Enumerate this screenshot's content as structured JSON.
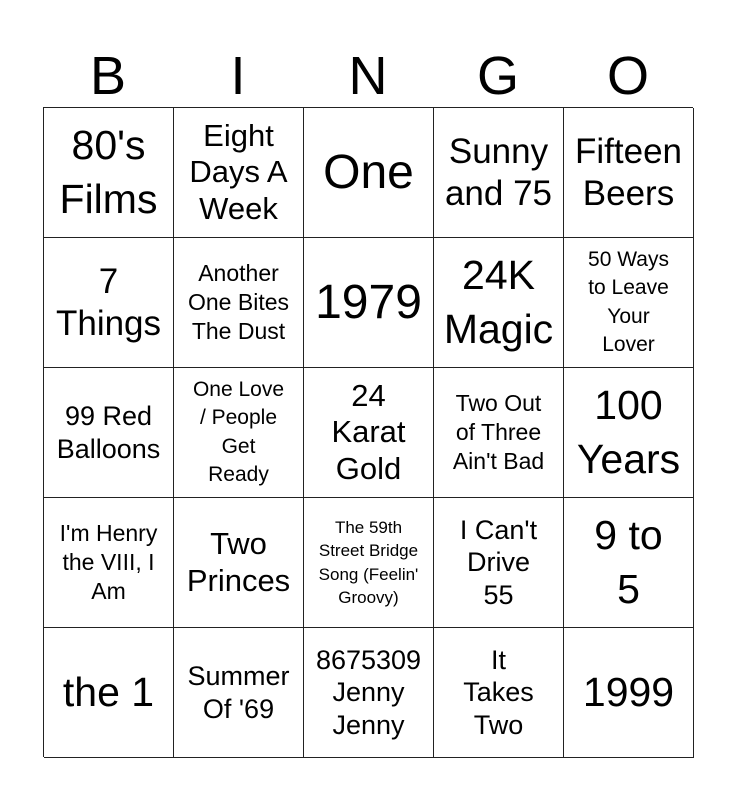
{
  "header": {
    "letters": [
      "B",
      "I",
      "N",
      "G",
      "O"
    ]
  },
  "board": {
    "rows": [
      [
        "80's\nFilms",
        "Eight\nDays A\nWeek",
        "One",
        "Sunny\nand 75",
        "Fifteen\nBeers"
      ],
      [
        "7\nThings",
        "Another\nOne Bites\nThe Dust",
        "1979",
        "24K\nMagic",
        "50 Ways\nto Leave\nYour\nLover"
      ],
      [
        "99 Red\nBalloons",
        "One Love\n/ People\nGet\nReady",
        "24\nKarat\nGold",
        "Two Out\nof Three\nAin't Bad",
        "100\nYears"
      ],
      [
        "I'm Henry\nthe VIII, I\nAm",
        "Two\nPrinces",
        "The 59th\nStreet Bridge\nSong (Feelin'\nGroovy)",
        "I Can't\nDrive\n55",
        "9 to\n5"
      ],
      [
        "the 1",
        "Summer\nOf '69",
        "8675309\nJenny\nJenny",
        "It\nTakes\nTwo",
        "1999"
      ]
    ]
  },
  "colors": {
    "background": "#ffffff",
    "text": "#000000",
    "grid_lines": "#222222"
  }
}
